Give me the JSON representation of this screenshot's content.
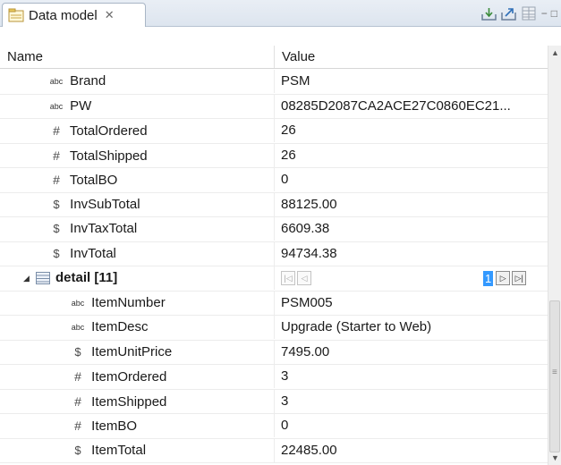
{
  "tab": {
    "title": "Data model",
    "close": "✕"
  },
  "toolbar": {
    "icons": [
      "collapse-all-icon",
      "export-icon",
      "table-layout-icon"
    ],
    "minimize": "−",
    "maximize": "□"
  },
  "columns": {
    "name": "Name",
    "value": "Value"
  },
  "rows": [
    {
      "type": "abc",
      "name": "Brand",
      "value": "PSM"
    },
    {
      "type": "abc",
      "name": "PW",
      "value": "08285D2087CA2ACE27C0860EC21..."
    },
    {
      "type": "#",
      "name": "TotalOrdered",
      "value": "26"
    },
    {
      "type": "#",
      "name": "TotalShipped",
      "value": "26"
    },
    {
      "type": "#",
      "name": "TotalBO",
      "value": "0"
    },
    {
      "type": "$",
      "name": "InvSubTotal",
      "value": "88125.00"
    },
    {
      "type": "$",
      "name": "InvTaxTotal",
      "value": "6609.38"
    },
    {
      "type": "$",
      "name": "InvTotal",
      "value": "94734.38"
    }
  ],
  "detail": {
    "name": "detail [11]",
    "page": "1"
  },
  "detail_rows": [
    {
      "type": "abc",
      "name": "ItemNumber",
      "value": "PSM005"
    },
    {
      "type": "abc",
      "name": "ItemDesc",
      "value": "Upgrade (Starter to Web)"
    },
    {
      "type": "$",
      "name": "ItemUnitPrice",
      "value": "7495.00"
    },
    {
      "type": "#",
      "name": "ItemOrdered",
      "value": "3"
    },
    {
      "type": "#",
      "name": "ItemShipped",
      "value": "3"
    },
    {
      "type": "#",
      "name": "ItemBO",
      "value": "0"
    },
    {
      "type": "$",
      "name": "ItemTotal",
      "value": "22485.00"
    }
  ]
}
